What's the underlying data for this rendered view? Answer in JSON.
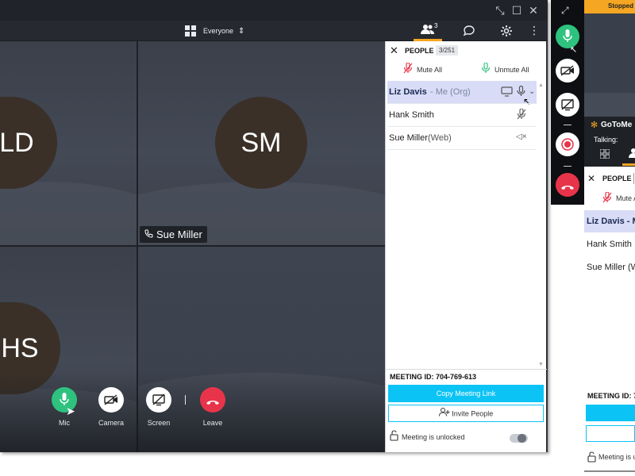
{
  "topbar": {
    "view_label": "Everyone",
    "people_count": "3"
  },
  "tiles": [
    {
      "initials": "LD"
    },
    {
      "initials": "SM",
      "name_chip": "Sue Miller"
    },
    {
      "initials": "HS"
    }
  ],
  "controls": {
    "mic": "Mic",
    "camera": "Camera",
    "screen": "Screen",
    "leave": "Leave"
  },
  "people_panel": {
    "title": "PEOPLE",
    "count": "3/251",
    "mute_all": "Mute All",
    "unmute_all": "Unmute All",
    "attendees": [
      {
        "name": "Liz Davis",
        "suffix": " - Me (Org)"
      },
      {
        "name": "Hank Smith",
        "suffix": ""
      },
      {
        "name": "Sue Miller",
        "suffix": " (Web)"
      }
    ],
    "meeting_id": "MEETING ID: 704-769-613",
    "copy_link": "Copy Meeting Link",
    "invite": "Invite People",
    "lock_status": "Meeting is unlocked"
  },
  "right_window": {
    "banner": "Stopped",
    "brand": "GoToMe",
    "talking": "Talking:",
    "people_title": "PEOPLE",
    "mute_all": "Mute A",
    "attendees": [
      "Liz Davis  - M",
      "Hank Smith",
      "Sue Miller  (W"
    ],
    "meeting_id": "MEETING ID: 7",
    "lock_status": "Meeting is u"
  },
  "colors": {
    "accent": "#0cc3f5",
    "mic_green": "#2ec27e",
    "leave_red": "#e8344a",
    "brand_orange": "#f5a623"
  }
}
